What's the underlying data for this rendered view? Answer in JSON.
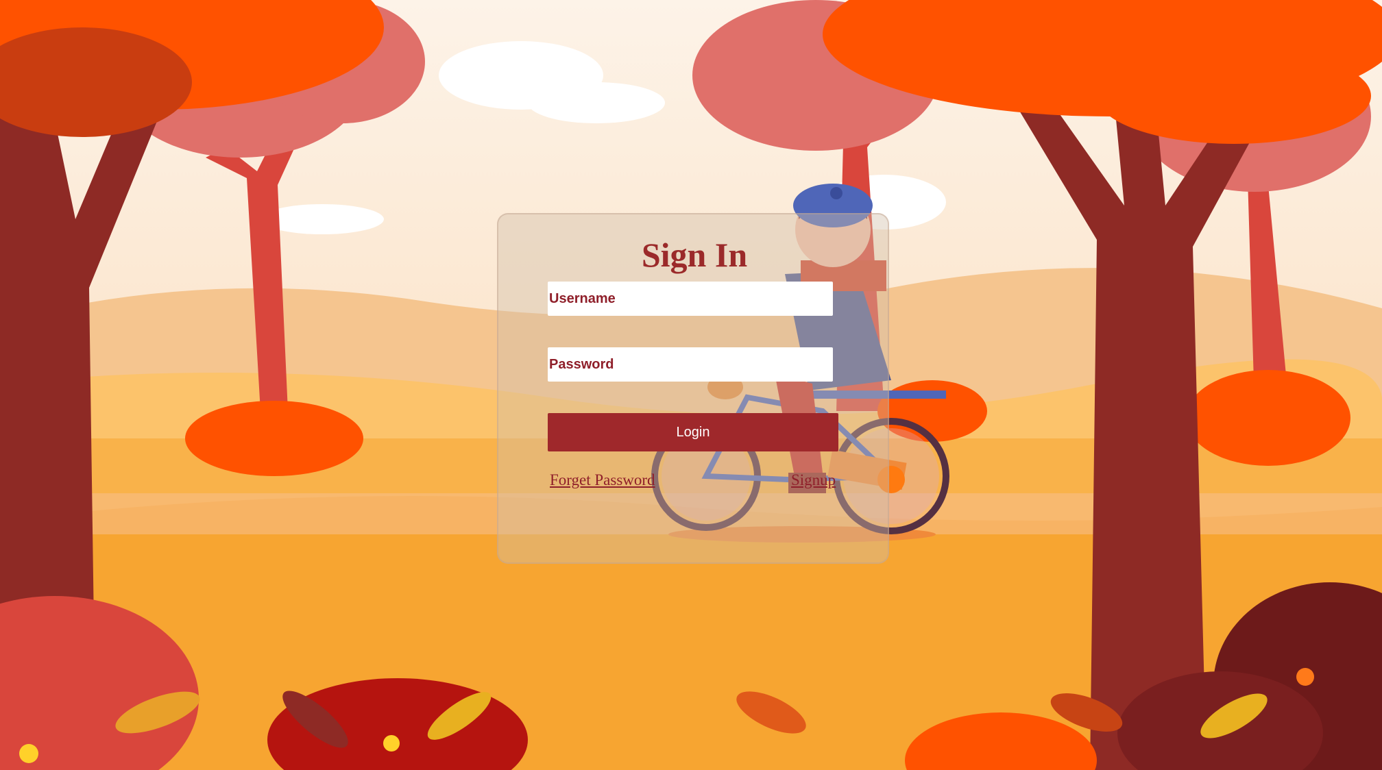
{
  "login": {
    "title": "Sign In",
    "username_placeholder": "Username",
    "password_placeholder": "Password",
    "login_label": "Login",
    "forgot_label": "Forget Password",
    "signup_label": "Signup"
  },
  "colors": {
    "accent": "#9f282b",
    "text_accent": "#8f1f2a",
    "sky": "#fdebd8",
    "ground": "#f7b03a",
    "tree_trunk": "#8e2a25",
    "foliage": "#ff5200"
  }
}
